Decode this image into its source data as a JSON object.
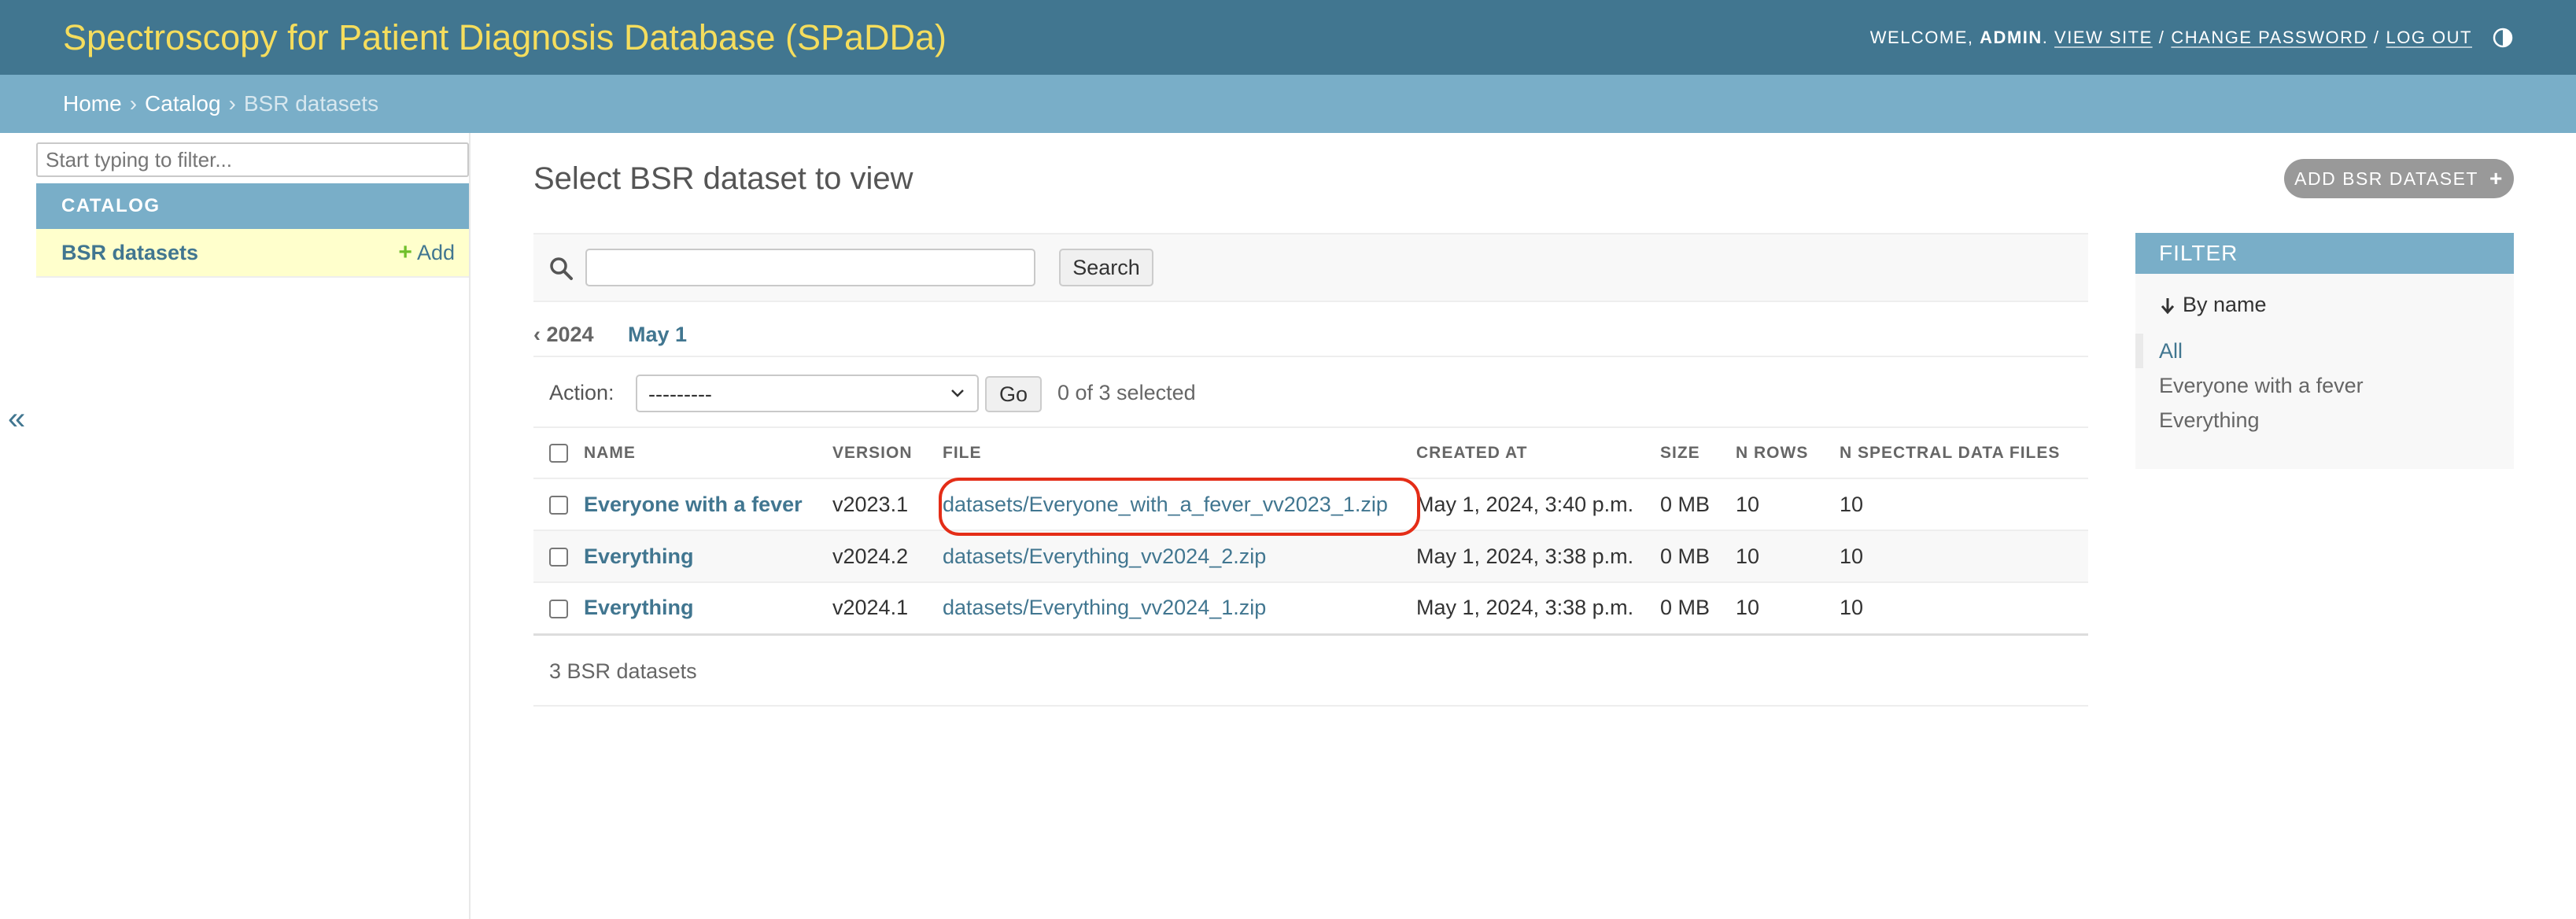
{
  "header": {
    "site_name": "Spectroscopy for Patient Diagnosis Database (SPaDDa)",
    "welcome": "Welcome,",
    "username": "admin",
    "view_site": "View site",
    "change_password": "Change password",
    "log_out": "Log out",
    "separator": "/",
    "period": "."
  },
  "breadcrumbs": {
    "home": "Home",
    "catalog": "Catalog",
    "current": "BSR datasets",
    "separator": "›"
  },
  "sidebar": {
    "filter_placeholder": "Start typing to filter...",
    "app_caption": "Catalog",
    "model_name": "BSR datasets",
    "add_label": "Add",
    "add_plus": "+",
    "collapse": "«"
  },
  "content": {
    "title": "Select BSR dataset to view",
    "add_button": "Add BSR dataset",
    "add_plus": "+"
  },
  "search": {
    "button": "Search",
    "value": ""
  },
  "date_hierarchy": {
    "back": "‹ 2024",
    "current": "May 1"
  },
  "actions": {
    "label": "Action:",
    "selected_value": "---------",
    "go": "Go",
    "counter": "0 of 3 selected"
  },
  "table": {
    "columns": [
      "Name",
      "Version",
      "File",
      "Created at",
      "Size",
      "N rows",
      "N spectral data files"
    ],
    "rows": [
      {
        "name": "Everyone with a fever",
        "version": "v2023.1",
        "file": "datasets/Everyone_with_a_fever_vv2023_1.zip",
        "created_at": "May 1, 2024, 3:40 p.m.",
        "size": "0 MB",
        "n_rows": "10",
        "n_files": "10"
      },
      {
        "name": "Everything",
        "version": "v2024.2",
        "file": "datasets/Everything_vv2024_2.zip",
        "created_at": "May 1, 2024, 3:38 p.m.",
        "size": "0 MB",
        "n_rows": "10",
        "n_files": "10"
      },
      {
        "name": "Everything",
        "version": "v2024.1",
        "file": "datasets/Everything_vv2024_1.zip",
        "created_at": "May 1, 2024, 3:38 p.m.",
        "size": "0 MB",
        "n_rows": "10",
        "n_files": "10"
      }
    ]
  },
  "paginator": {
    "count_text": "3 BSR datasets"
  },
  "filter": {
    "heading": "FILTER",
    "by_name": "By name",
    "options": [
      "All",
      "Everyone with a fever",
      "Everything"
    ],
    "selected": "All"
  },
  "colors": {
    "header_bg": "#417690",
    "site_name": "#f5dd5d",
    "breadcrumbs_bg": "#79aec8",
    "link": "#417690",
    "highlight_ring": "#e42d17",
    "selected_row": "#ffffcc"
  },
  "icons": {
    "theme_toggle": "half-circle-icon",
    "search": "magnifier-icon",
    "filter_arrow": "arrow-down-icon",
    "select_chevron": "chevron-down-icon"
  }
}
